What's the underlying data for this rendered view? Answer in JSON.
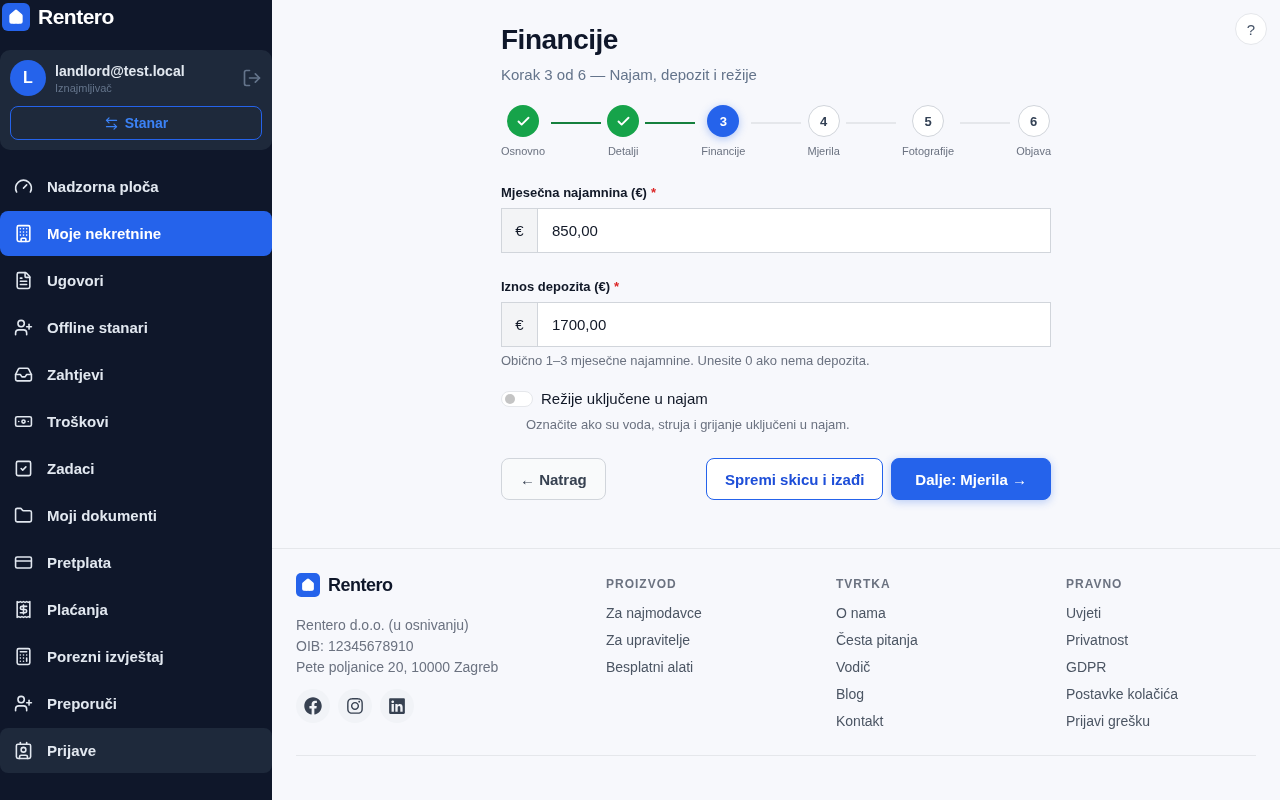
{
  "sidebar": {
    "brand": "Rentero",
    "account": {
      "avatar": "L",
      "email": "landlord@test.local",
      "role": "Iznajmljivač",
      "switch_label": "Stanar"
    },
    "items": [
      {
        "label": "Nadzorna ploča",
        "selected": false,
        "hovered": false
      },
      {
        "label": "Moje nekretnine",
        "selected": true,
        "hovered": false
      },
      {
        "label": "Ugovori",
        "selected": false,
        "hovered": false
      },
      {
        "label": "Offline stanari",
        "selected": false,
        "hovered": false
      },
      {
        "label": "Zahtjevi",
        "selected": false,
        "hovered": false
      },
      {
        "label": "Troškovi",
        "selected": false,
        "hovered": false
      },
      {
        "label": "Zadaci",
        "selected": false,
        "hovered": false
      },
      {
        "label": "Moji dokumenti",
        "selected": false,
        "hovered": false
      },
      {
        "label": "Pretplata",
        "selected": false,
        "hovered": false
      },
      {
        "label": "Plaćanja",
        "selected": false,
        "hovered": false
      },
      {
        "label": "Porezni izvještaj",
        "selected": false,
        "hovered": false
      },
      {
        "label": "Preporuči",
        "selected": false,
        "hovered": false
      },
      {
        "label": "Prijave",
        "selected": false,
        "hovered": true
      }
    ]
  },
  "help": "?",
  "page": {
    "title": "Financije",
    "subtitle": "Korak 3 od 6 — Najam, depozit i režije",
    "steps": [
      {
        "label": "Osnovno",
        "kind": "done"
      },
      {
        "label": "Detalji",
        "kind": "done"
      },
      {
        "label": "Financije",
        "number": "3",
        "kind": "current"
      },
      {
        "label": "Mjerila",
        "number": "4",
        "kind": "todo"
      },
      {
        "label": "Fotografije",
        "number": "5",
        "kind": "todo"
      },
      {
        "label": "Objava",
        "number": "6",
        "kind": "todo"
      }
    ],
    "fields": [
      {
        "label": "Mjesečna najamnina (€)",
        "required_mark": "*",
        "prefix": "€",
        "value": "850,00"
      },
      {
        "label": "Iznos depozita (€)",
        "required_mark": "*",
        "prefix": "€",
        "value": "1700,00",
        "hint": "Obično 1–3 mjesečne najamnine. Unesite 0 ako nema depozita."
      }
    ],
    "utilities": {
      "label": "Režije uključene u najam",
      "on": false,
      "hint": "Označite ako su voda, struja i grijanje uključeni u najam."
    },
    "buttons": {
      "back": "← Natrag",
      "save": "Spremi skicu i izađi",
      "next": "Dalje: Mjerila →"
    }
  },
  "footer": {
    "brand": "Rentero",
    "company": [
      "Rentero d.o.o. (u osnivanju)",
      "OIB: 12345678910",
      "Pete poljanice 20, 10000 Zagreb"
    ],
    "columns": [
      {
        "title": "PROIZVOD",
        "links": [
          "Za najmodavce",
          "Za upravitelje",
          "Besplatni alati"
        ]
      },
      {
        "title": "TVRTKA",
        "links": [
          "O nama",
          "Česta pitanja",
          "Vodič",
          "Blog",
          "Kontakt"
        ]
      },
      {
        "title": "PRAVNO",
        "links": [
          "Uvjeti",
          "Privatnost",
          "GDPR",
          "Postavke kolačića",
          "Prijavi grešku"
        ]
      }
    ]
  }
}
